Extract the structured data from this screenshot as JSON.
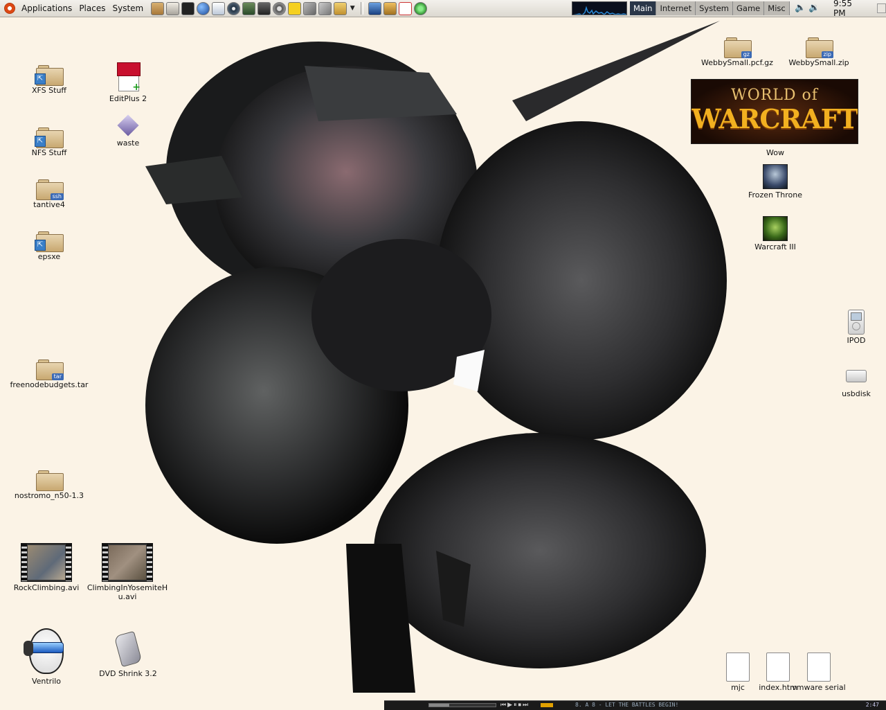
{
  "top_panel": {
    "menus": [
      "Applications",
      "Places",
      "System"
    ],
    "launchers": [
      "file-cabinet-icon",
      "home-icon",
      "terminal-icon",
      "globe-icon",
      "mail-icon",
      "audio-icon",
      "network-icon",
      "camera-icon",
      "settings-icon",
      "notes-icon",
      "tool-icon",
      "tool-icon-2",
      "keys-icon",
      "thunderbird-icon",
      "gimp-icon",
      "pdf-icon",
      "refresh-icon"
    ],
    "workspaces": [
      {
        "label": "Main",
        "active": true
      },
      {
        "label": "Internet",
        "active": false
      },
      {
        "label": "System",
        "active": false
      },
      {
        "label": "Game",
        "active": false
      },
      {
        "label": "Misc",
        "active": false
      }
    ],
    "clock": "9:55 PM"
  },
  "desktop": {
    "left_icons": {
      "xfs": "XFS Stuff",
      "editplus": "EditPlus 2",
      "waste": "waste",
      "nfs": "NFS Stuff",
      "tantive": "tantive4",
      "ssh_tag": "ssh",
      "epsxe": "epsxe",
      "freenode": "freenodebudgets.tar",
      "tar_tag": "tar",
      "nostromo": "nostromo_n50-1.3",
      "rock": "RockClimbing.avi",
      "climbing": "ClimbingInYosemiteHu.avi",
      "ventrilo": "Ventrilo",
      "dvdshrink": "DVD Shrink 3.2"
    },
    "right_icons": {
      "webby_gz": "WebbySmall.pcf.gz",
      "gz_tag": "gz",
      "webby_zip": "WebbySmall.zip",
      "zip_tag": "zip",
      "wow": "Wow",
      "wow_banner_top": "WORLD of",
      "wow_banner_main": "WARCRAFT",
      "frozen": "Frozen Throne",
      "warcraft3": "Warcraft III",
      "ipod": "IPOD",
      "usbdisk": "usbdisk",
      "mjc": "mjc",
      "index": "index.htm",
      "vmware": "vmware serial"
    }
  },
  "media_player": {
    "ticker": "8.     A  8  - LET THE BATTLES BEGIN!",
    "time": "2:47",
    "progress": 0.3
  },
  "colors": {
    "desktop_bg": "#fbf3e6",
    "panel_bg": "#dcd8d0",
    "active_workspace": "#2a3648"
  }
}
